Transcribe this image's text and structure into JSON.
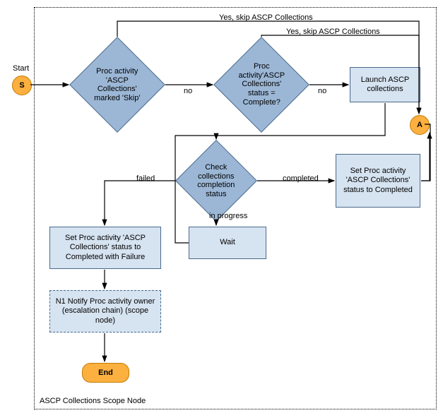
{
  "chart_data": {
    "type": "flowchart",
    "title": "ASCP Collections Scope Node",
    "nodes": [
      {
        "id": "start",
        "kind": "terminator",
        "label": "S",
        "caption": "Start"
      },
      {
        "id": "end",
        "kind": "terminator",
        "label": "End"
      },
      {
        "id": "A",
        "kind": "connector",
        "label": "A"
      },
      {
        "id": "d_skip",
        "kind": "decision",
        "text": "Proc activity 'ASCP Collections' marked 'Skip'"
      },
      {
        "id": "d_complete",
        "kind": "decision",
        "text": "Proc activity'ASCP Collections' status = Complete?"
      },
      {
        "id": "d_check",
        "kind": "decision",
        "text": "Check collections completion status"
      },
      {
        "id": "p_launch",
        "kind": "process",
        "text": "Launch ASCP collections"
      },
      {
        "id": "p_wait",
        "kind": "process",
        "text": "Wait"
      },
      {
        "id": "p_set_done",
        "kind": "process",
        "text": "Set Proc activity 'ASCP Collections' status to Completed"
      },
      {
        "id": "p_set_fail",
        "kind": "process",
        "text": "Set Proc activity 'ASCP Collections' status to Completed with Failure"
      },
      {
        "id": "p_notify",
        "kind": "process",
        "text": "N1 Notify Proc activity owner (escalation chain) (scope node)"
      }
    ],
    "edges": [
      {
        "from": "start",
        "to": "d_skip"
      },
      {
        "from": "d_skip",
        "to": "A",
        "label": "Yes, skip ASCP Collections"
      },
      {
        "from": "d_skip",
        "to": "d_complete",
        "label": "no"
      },
      {
        "from": "d_complete",
        "to": "A",
        "label": "Yes, skip ASCP Collections"
      },
      {
        "from": "d_complete",
        "to": "p_launch",
        "label": "no"
      },
      {
        "from": "p_launch",
        "to": "d_check"
      },
      {
        "from": "d_check",
        "to": "p_set_done",
        "label": "completed"
      },
      {
        "from": "p_set_done",
        "to": "A"
      },
      {
        "from": "d_check",
        "to": "p_wait",
        "label": "in progress"
      },
      {
        "from": "p_wait",
        "to": "d_check"
      },
      {
        "from": "d_check",
        "to": "p_set_fail",
        "label": "failed"
      },
      {
        "from": "p_set_fail",
        "to": "p_notify"
      },
      {
        "from": "p_notify",
        "to": "end"
      }
    ]
  },
  "labels": {
    "start_caption": "Start",
    "start_letter": "S",
    "connector_A": "A",
    "end": "End",
    "frame": "ASCP Collections Scope Node",
    "d_skip": "Proc activity 'ASCP Collections' marked 'Skip'",
    "d_complete": "Proc activity'ASCP Collections' status = Complete?",
    "d_check": "Check collections completion status",
    "p_launch": "Launch ASCP collections",
    "p_wait": "Wait",
    "p_set_done": "Set Proc activity 'ASCP Collections' status to Completed",
    "p_set_fail": "Set Proc activity 'ASCP Collections' status to Completed with Failure",
    "p_notify": "N1 Notify Proc activity owner (escalation chain) (scope node)",
    "edge_yes_skip": "Yes, skip ASCP Collections",
    "edge_no": "no",
    "edge_completed": "completed",
    "edge_inprogress": "in progress",
    "edge_failed": "failed"
  }
}
